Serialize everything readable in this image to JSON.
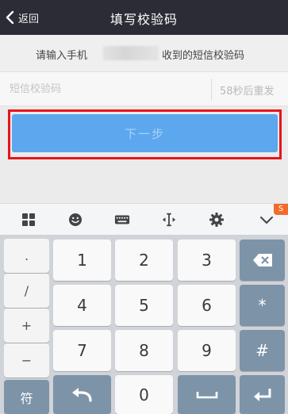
{
  "header": {
    "back_label": "返回",
    "title": "填写校验码"
  },
  "prompt": {
    "text_before": "请输入手机",
    "text_after": "收到的短信校验码"
  },
  "code_input": {
    "placeholder": "短信校验码",
    "value": ""
  },
  "resend": {
    "label": "58秒后重发"
  },
  "next_button": {
    "label": "下一步"
  },
  "keyboard_toolbar": {
    "icons": [
      "grid-icon",
      "emoji-icon",
      "keyboard-icon",
      "cursor-icon",
      "gear-icon",
      "chevron-down-icon"
    ],
    "logo_text": "S"
  },
  "keyboard": {
    "side_keys": [
      ".",
      "/",
      "+",
      "−"
    ],
    "symbol_key": "符",
    "digits": [
      "1",
      "2",
      "3",
      "4",
      "5",
      "6",
      "7",
      "8",
      "9",
      "0"
    ],
    "right_keys": {
      "star": "*",
      "hash": "#"
    }
  },
  "colors": {
    "header_bg": "#2c2c36",
    "button_bg": "#5da7ee",
    "highlight": "#e8141b",
    "key_blue": "#7d93a8"
  }
}
